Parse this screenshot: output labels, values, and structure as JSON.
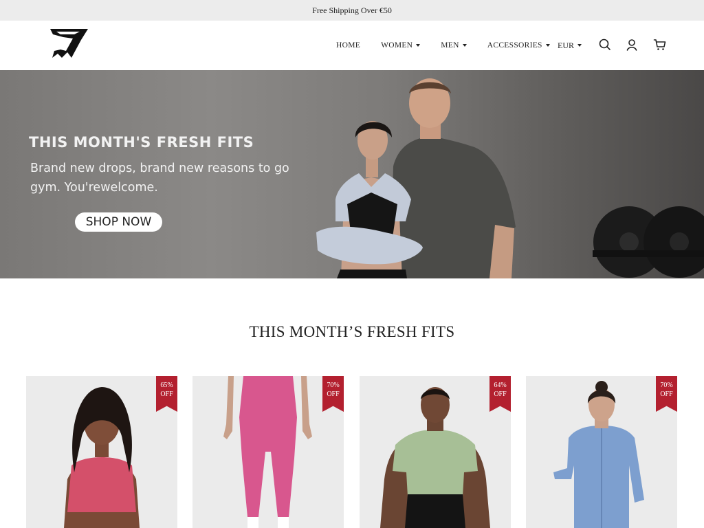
{
  "announcement": "Free Shipping Over €50",
  "nav": {
    "home": "HOME",
    "women": "WOMEN",
    "men": "MEN",
    "accessories": "ACCESSORIES"
  },
  "currency": "EUR",
  "icons": [
    "search-icon",
    "account-icon",
    "cart-icon",
    "chevron-down-icon"
  ],
  "hero": {
    "title": "THIS MONTH'S FRESH FITS",
    "subtitle": "Brand new drops, brand new reasons to go gym. You'rewelcome.",
    "cta": "SHOP NOW"
  },
  "section_title": "THIS MONTH’S FRESH FITS",
  "products": [
    {
      "discount": "65%",
      "off": "OFF",
      "product_color": "#d4506a"
    },
    {
      "discount": "70%",
      "off": "OFF",
      "product_color": "#d8578e"
    },
    {
      "discount": "64%",
      "off": "OFF",
      "product_color": "#a7bf96"
    },
    {
      "discount": "70%",
      "off": "OFF",
      "product_color": "#7d9fcf"
    }
  ],
  "colors": {
    "announcement_bg": "#ececec",
    "badge": "#b3202f",
    "card_bg": "#ebebeb"
  }
}
